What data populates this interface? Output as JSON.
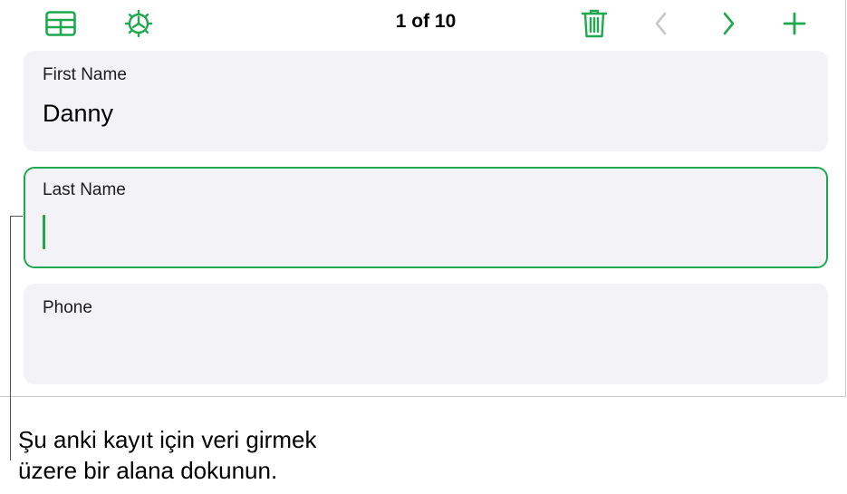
{
  "toolbar": {
    "counter": "1 of 10",
    "icons": {
      "table": "table-icon",
      "settings": "gear-icon",
      "delete": "trash-icon",
      "prev": "chevron-left-icon",
      "next": "chevron-right-icon",
      "add": "plus-icon"
    }
  },
  "fields": [
    {
      "label": "First Name",
      "value": "Danny"
    },
    {
      "label": "Last Name",
      "value": ""
    },
    {
      "label": "Phone",
      "value": ""
    }
  ],
  "callout": {
    "line1": "Şu anki kayıt için veri girmek",
    "line2": "üzere bir alana dokunun."
  },
  "colors": {
    "accent": "#1fa84e",
    "disabled": "#c7c7cc",
    "field_bg": "#f2f2f7"
  }
}
